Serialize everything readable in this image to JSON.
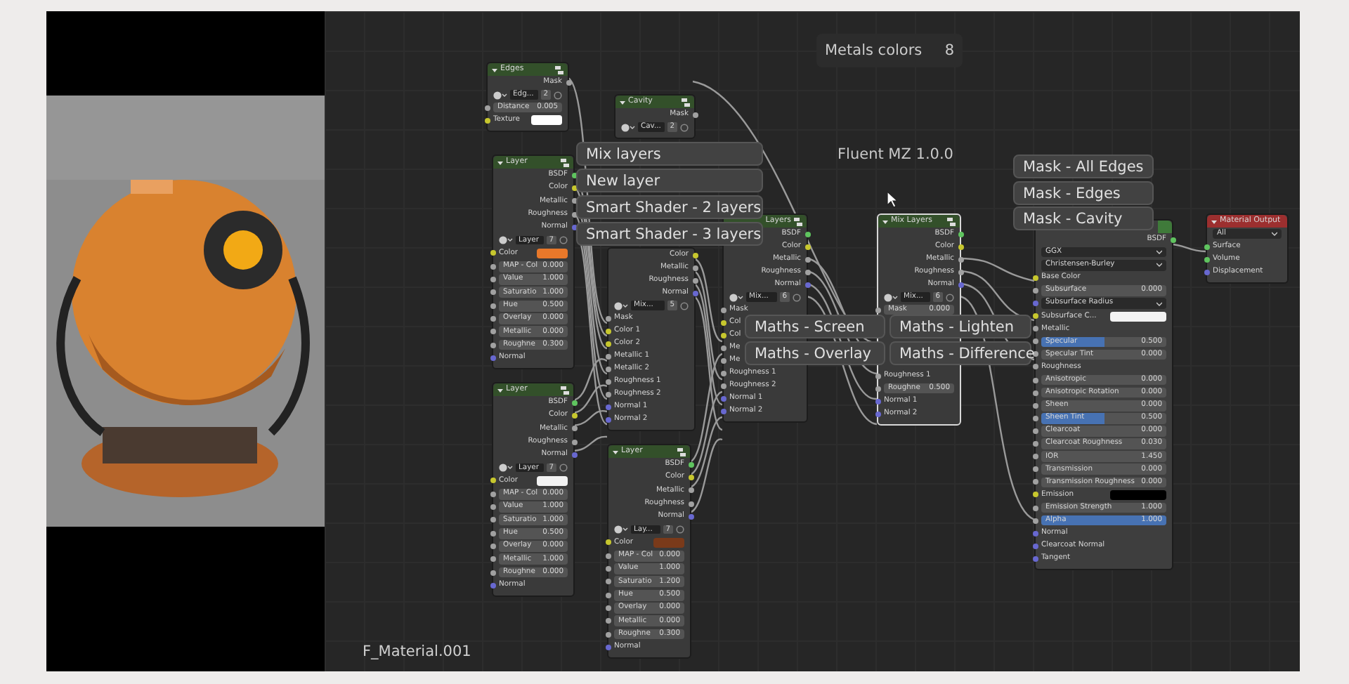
{
  "overlay_panel": {
    "title": "Metals colors",
    "count": "8"
  },
  "addon_label": "Fluent MZ 1.0.0",
  "material_name": "F_Material.001",
  "nodes": [
    {
      "kind": "group",
      "title": "Edges",
      "selected": false,
      "rows": [
        {
          "kind": "output",
          "label": "Mask",
          "socket": {
            "kind": "float"
          }
        },
        {
          "kind": "selector",
          "name": "Edg...",
          "count": "2"
        },
        {
          "kind": "field",
          "label": "Distance",
          "value": "0.005",
          "socket": {
            "kind": "float"
          }
        },
        {
          "kind": "color",
          "label": "Texture",
          "color": "#ffffff",
          "socket": {
            "kind": "color"
          }
        }
      ]
    },
    {
      "kind": "group",
      "title": "Cavity",
      "selected": false,
      "rows": [
        {
          "kind": "output",
          "label": "Mask",
          "socket": {
            "kind": "float"
          }
        },
        {
          "kind": "selector",
          "name": "Cav...",
          "count": "2"
        }
      ]
    },
    {
      "kind": "group",
      "title": "Layer",
      "selected": false,
      "rows": [
        {
          "kind": "output",
          "label": "BSDF",
          "socket": {
            "kind": "shader"
          }
        },
        {
          "kind": "output",
          "label": "Color",
          "socket": {
            "kind": "color"
          }
        },
        {
          "kind": "output",
          "label": "Metallic",
          "socket": {
            "kind": "float"
          }
        },
        {
          "kind": "output",
          "label": "Roughness",
          "socket": {
            "kind": "float"
          }
        },
        {
          "kind": "output",
          "label": "Normal",
          "socket": {
            "kind": "vector"
          }
        },
        {
          "kind": "selector",
          "name": "Layer",
          "count": "7"
        },
        {
          "kind": "color",
          "label": "Color",
          "color": "#e8782a",
          "socket": {
            "kind": "color"
          }
        },
        {
          "kind": "field",
          "label": "MAP - Col",
          "value": "0.000",
          "socket": {
            "kind": "float"
          }
        },
        {
          "kind": "field",
          "label": "Value",
          "value": "1.000",
          "socket": {
            "kind": "float"
          }
        },
        {
          "kind": "field",
          "label": "Saturatio",
          "value": "1.000",
          "socket": {
            "kind": "float"
          }
        },
        {
          "kind": "field",
          "label": "Hue",
          "value": "0.500",
          "socket": {
            "kind": "float"
          }
        },
        {
          "kind": "field",
          "label": "Overlay",
          "value": "0.000",
          "socket": {
            "kind": "float"
          }
        },
        {
          "kind": "field",
          "label": "Metallic",
          "value": "0.000",
          "socket": {
            "kind": "float"
          }
        },
        {
          "kind": "field",
          "label": "Roughne",
          "value": "0.300",
          "socket": {
            "kind": "float"
          }
        },
        {
          "kind": "input",
          "label": "Normal",
          "socket": {
            "kind": "vector"
          }
        }
      ]
    },
    {
      "kind": "group",
      "selected": false,
      "rows": [
        {
          "kind": "output",
          "label": "Color",
          "socket": {
            "kind": "color"
          }
        },
        {
          "kind": "output",
          "label": "Metallic",
          "socket": {
            "kind": "float"
          }
        },
        {
          "kind": "output",
          "label": "Roughness",
          "socket": {
            "kind": "float"
          }
        },
        {
          "kind": "output",
          "label": "Normal",
          "socket": {
            "kind": "vector"
          }
        },
        {
          "kind": "selector",
          "name": "Mix...",
          "count": "5"
        },
        {
          "kind": "input",
          "label": "Mask",
          "socket": {
            "kind": "float"
          }
        },
        {
          "kind": "input",
          "label": "Color 1",
          "socket": {
            "kind": "color"
          }
        },
        {
          "kind": "input",
          "label": "Color 2",
          "socket": {
            "kind": "color"
          }
        },
        {
          "kind": "input",
          "label": "Metallic 1",
          "socket": {
            "kind": "float"
          }
        },
        {
          "kind": "input",
          "label": "Metallic 2",
          "socket": {
            "kind": "float"
          }
        },
        {
          "kind": "input",
          "label": "Roughness 1",
          "socket": {
            "kind": "float"
          }
        },
        {
          "kind": "input",
          "label": "Roughness 2",
          "socket": {
            "kind": "float"
          }
        },
        {
          "kind": "input",
          "label": "Normal 1",
          "socket": {
            "kind": "vector"
          }
        },
        {
          "kind": "input",
          "label": "Normal 2",
          "socket": {
            "kind": "vector"
          }
        }
      ]
    },
    {
      "kind": "group",
      "title": "Layers",
      "selected": false,
      "rows": [
        {
          "kind": "output",
          "label": "BSDF",
          "socket": {
            "kind": "shader"
          }
        },
        {
          "kind": "output",
          "label": "Color",
          "socket": {
            "kind": "color"
          }
        },
        {
          "kind": "output",
          "label": "Metallic",
          "socket": {
            "kind": "float"
          }
        },
        {
          "kind": "output",
          "label": "Roughness",
          "socket": {
            "kind": "float"
          }
        },
        {
          "kind": "output",
          "label": "Normal",
          "socket": {
            "kind": "vector"
          }
        },
        {
          "kind": "selector",
          "name": "Mix...",
          "count": "6"
        },
        {
          "kind": "input",
          "label": "Mask",
          "socket": {
            "kind": "float"
          }
        },
        {
          "kind": "input",
          "label": "Col",
          "socket": {
            "kind": "color"
          }
        },
        {
          "kind": "input",
          "label": "Col",
          "socket": {
            "kind": "color"
          }
        },
        {
          "kind": "input",
          "label": "Me",
          "socket": {
            "kind": "float"
          }
        },
        {
          "kind": "input",
          "label": "Me",
          "socket": {
            "kind": "float"
          }
        },
        {
          "kind": "input",
          "label": "Roughness 1",
          "socket": {
            "kind": "float"
          }
        },
        {
          "kind": "input",
          "label": "Roughness 2",
          "socket": {
            "kind": "float"
          }
        },
        {
          "kind": "input",
          "label": "Normal 1",
          "socket": {
            "kind": "vector"
          }
        },
        {
          "kind": "input",
          "label": "Normal 2",
          "socket": {
            "kind": "vector"
          }
        }
      ]
    },
    {
      "kind": "group",
      "title": "Mix Layers",
      "selected": true,
      "rows": [
        {
          "kind": "output",
          "label": "BSDF",
          "socket": {
            "kind": "shader"
          }
        },
        {
          "kind": "output",
          "label": "Color",
          "socket": {
            "kind": "color"
          }
        },
        {
          "kind": "output",
          "label": "Metallic",
          "socket": {
            "kind": "float"
          }
        },
        {
          "kind": "output",
          "label": "Roughness",
          "socket": {
            "kind": "float"
          }
        },
        {
          "kind": "output",
          "label": "Normal",
          "socket": {
            "kind": "vector"
          }
        },
        {
          "kind": "selector",
          "name": "Mix...",
          "count": "6"
        },
        {
          "kind": "field",
          "label": "Mask",
          "value": "0.000",
          "socket": {
            "kind": "float"
          }
        },
        {
          "kind": "input",
          "label": "Roughness 1",
          "socket": {
            "kind": "float"
          }
        },
        {
          "kind": "field",
          "label": "Roughne",
          "value": "0.500",
          "socket": {
            "kind": "float"
          }
        },
        {
          "kind": "input",
          "label": "Normal 1",
          "socket": {
            "kind": "vector"
          }
        },
        {
          "kind": "input",
          "label": "Normal 2",
          "socket": {
            "kind": "vector"
          }
        }
      ]
    },
    {
      "kind": "group",
      "title": "Layer",
      "selected": false,
      "rows": [
        {
          "kind": "output",
          "label": "BSDF",
          "socket": {
            "kind": "shader"
          }
        },
        {
          "kind": "output",
          "label": "Color",
          "socket": {
            "kind": "color"
          }
        },
        {
          "kind": "output",
          "label": "Metallic",
          "socket": {
            "kind": "float"
          }
        },
        {
          "kind": "output",
          "label": "Roughness",
          "socket": {
            "kind": "float"
          }
        },
        {
          "kind": "output",
          "label": "Normal",
          "socket": {
            "kind": "vector"
          }
        },
        {
          "kind": "selector",
          "name": "Layer",
          "count": "7"
        },
        {
          "kind": "color",
          "label": "Color",
          "color": "#f2f2f2",
          "socket": {
            "kind": "color"
          }
        },
        {
          "kind": "field",
          "label": "MAP - Col",
          "value": "0.000",
          "socket": {
            "kind": "float"
          }
        },
        {
          "kind": "field",
          "label": "Value",
          "value": "1.000",
          "socket": {
            "kind": "float"
          }
        },
        {
          "kind": "field",
          "label": "Saturatio",
          "value": "1.000",
          "socket": {
            "kind": "float"
          }
        },
        {
          "kind": "field",
          "label": "Hue",
          "value": "0.500",
          "socket": {
            "kind": "float"
          }
        },
        {
          "kind": "field",
          "label": "Overlay",
          "value": "0.000",
          "socket": {
            "kind": "float"
          }
        },
        {
          "kind": "field",
          "label": "Metallic",
          "value": "1.000",
          "socket": {
            "kind": "float"
          }
        },
        {
          "kind": "field",
          "label": "Roughne",
          "value": "0.000",
          "socket": {
            "kind": "float"
          }
        },
        {
          "kind": "input",
          "label": "Normal",
          "socket": {
            "kind": "vector"
          }
        }
      ]
    },
    {
      "kind": "group",
      "title": "Layer",
      "selected": false,
      "rows": [
        {
          "kind": "output",
          "label": "BSDF",
          "socket": {
            "kind": "shader"
          }
        },
        {
          "kind": "output",
          "label": "Color",
          "socket": {
            "kind": "color"
          }
        },
        {
          "kind": "output",
          "label": "Metallic",
          "socket": {
            "kind": "float"
          }
        },
        {
          "kind": "output",
          "label": "Roughness",
          "socket": {
            "kind": "float"
          }
        },
        {
          "kind": "output",
          "label": "Normal",
          "socket": {
            "kind": "vector"
          }
        },
        {
          "kind": "selector",
          "name": "Lay...",
          "count": "7"
        },
        {
          "kind": "color",
          "label": "Color",
          "color": "#7a3a1a",
          "socket": {
            "kind": "color"
          }
        },
        {
          "kind": "field",
          "label": "MAP - Col",
          "value": "0.000",
          "socket": {
            "kind": "float"
          }
        },
        {
          "kind": "field",
          "label": "Value",
          "value": "1.000",
          "socket": {
            "kind": "float"
          }
        },
        {
          "kind": "field",
          "label": "Saturatio",
          "value": "1.200",
          "socket": {
            "kind": "float"
          }
        },
        {
          "kind": "field",
          "label": "Hue",
          "value": "0.500",
          "socket": {
            "kind": "float"
          }
        },
        {
          "kind": "field",
          "label": "Overlay",
          "value": "0.000",
          "socket": {
            "kind": "float"
          }
        },
        {
          "kind": "field",
          "label": "Metallic",
          "value": "0.000",
          "socket": {
            "kind": "float"
          }
        },
        {
          "kind": "field",
          "label": "Roughne",
          "value": "0.300",
          "socket": {
            "kind": "float"
          }
        },
        {
          "kind": "input",
          "label": "Normal",
          "socket": {
            "kind": "vector"
          }
        }
      ]
    },
    {
      "kind": "shader",
      "selected": false,
      "rows": [
        {
          "kind": "output",
          "label": "BSDF",
          "socket": {
            "kind": "shader"
          }
        },
        {
          "kind": "dropdown",
          "label": "GGX"
        },
        {
          "kind": "dropdown",
          "label": "Christensen-Burley"
        },
        {
          "kind": "input",
          "label": "Base Color",
          "socket": {
            "kind": "color"
          }
        },
        {
          "kind": "field",
          "label": "Subsurface",
          "value": "0.000",
          "socket": {
            "kind": "float"
          }
        },
        {
          "kind": "dropdown",
          "label": "Subsurface Radius",
          "socket": {
            "kind": "vector"
          }
        },
        {
          "kind": "color",
          "label": "Subsurface C...",
          "color": "#f2f2f2",
          "socket": {
            "kind": "color"
          }
        },
        {
          "kind": "input",
          "label": "Metallic",
          "socket": {
            "kind": "float"
          }
        },
        {
          "kind": "field",
          "label": "Specular",
          "value": "0.500",
          "level": 0.5,
          "socket": {
            "kind": "float"
          }
        },
        {
          "kind": "field",
          "label": "Specular Tint",
          "value": "0.000",
          "socket": {
            "kind": "float"
          }
        },
        {
          "kind": "input",
          "label": "Roughness",
          "socket": {
            "kind": "float"
          }
        },
        {
          "kind": "field",
          "label": "Anisotropic",
          "value": "0.000",
          "socket": {
            "kind": "float"
          }
        },
        {
          "kind": "field",
          "label": "Anisotropic Rotation",
          "value": "0.000",
          "socket": {
            "kind": "float"
          }
        },
        {
          "kind": "field",
          "label": "Sheen",
          "value": "0.000",
          "socket": {
            "kind": "float"
          }
        },
        {
          "kind": "field",
          "label": "Sheen Tint",
          "value": "0.500",
          "level": 0.5,
          "socket": {
            "kind": "float"
          }
        },
        {
          "kind": "field",
          "label": "Clearcoat",
          "value": "0.000",
          "socket": {
            "kind": "float"
          }
        },
        {
          "kind": "field",
          "label": "Clearcoat Roughness",
          "value": "0.030",
          "socket": {
            "kind": "float"
          }
        },
        {
          "kind": "field",
          "label": "IOR",
          "value": "1.450",
          "socket": {
            "kind": "float"
          }
        },
        {
          "kind": "field",
          "label": "Transmission",
          "value": "0.000",
          "socket": {
            "kind": "float"
          }
        },
        {
          "kind": "field",
          "label": "Transmission Roughness",
          "value": "0.000",
          "socket": {
            "kind": "float"
          }
        },
        {
          "kind": "color",
          "label": "Emission",
          "color": "#000000",
          "socket": {
            "kind": "color"
          }
        },
        {
          "kind": "field",
          "label": "Emission Strength",
          "value": "1.000",
          "socket": {
            "kind": "float"
          }
        },
        {
          "kind": "field",
          "label": "Alpha",
          "value": "1.000",
          "level": 1,
          "socket": {
            "kind": "float"
          }
        },
        {
          "kind": "input",
          "label": "Normal",
          "socket": {
            "kind": "vector"
          }
        },
        {
          "kind": "input",
          "label": "Clearcoat Normal",
          "socket": {
            "kind": "vector"
          }
        },
        {
          "kind": "input",
          "label": "Tangent",
          "socket": {
            "kind": "vector"
          }
        }
      ]
    },
    {
      "kind": "output",
      "title": "Material Output",
      "selected": false,
      "rows": [
        {
          "kind": "dropdown",
          "label": "All"
        },
        {
          "kind": "input",
          "label": "Surface",
          "socket": {
            "kind": "shader"
          }
        },
        {
          "kind": "input",
          "label": "Volume",
          "socket": {
            "kind": "shader"
          }
        },
        {
          "kind": "input",
          "label": "Displacement",
          "socket": {
            "kind": "vector"
          }
        }
      ]
    }
  ],
  "pie_menu_items": [
    "Mix layers",
    "New layer",
    "Smart Shader - 2 layers",
    "Smart Shader - 3 layers",
    "Maths - Screen",
    "Maths - Overlay",
    "Maths - Lighten",
    "Maths - Difference",
    "Mask - All Edges",
    "Mask - Edges",
    "Mask - Cavity"
  ]
}
